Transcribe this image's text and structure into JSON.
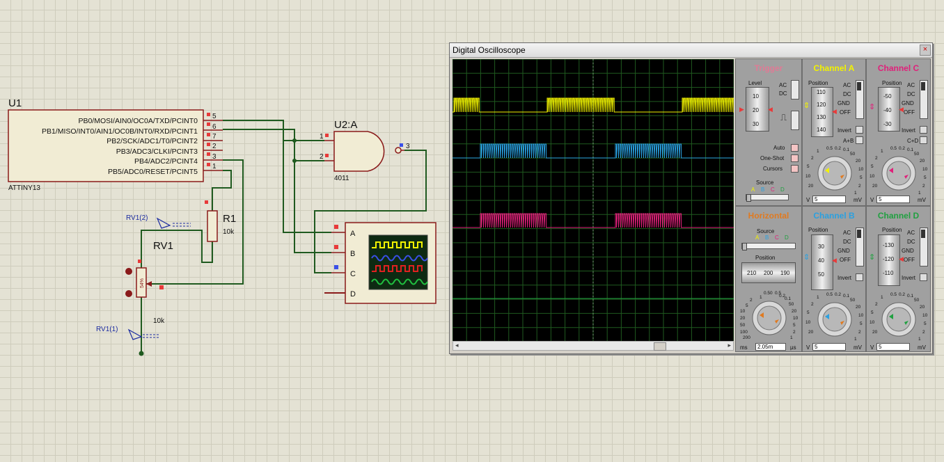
{
  "schematic": {
    "u1": {
      "ref": "U1",
      "part": "ATTINY13",
      "pins": [
        {
          "name": "PB0/MOSI/AIN0/OC0A/TXD/PCINT0",
          "num": "5"
        },
        {
          "name": "PB1/MISO/INT0/AIN1/OC0B/INT0/RXD/PCINT1",
          "num": "6"
        },
        {
          "name": "PB2/SCK/ADC1/T0/PCINT2",
          "num": "7"
        },
        {
          "name": "PB3/ADC3/CLKI/PCINT3",
          "num": "2"
        },
        {
          "name": "PB4/ADC2/PCINT4",
          "num": "3"
        },
        {
          "name": "PB5/ADC0/RESET/PCINT5",
          "num": "1"
        }
      ]
    },
    "u2": {
      "ref": "U2:A",
      "part": "4011",
      "pin1": "1",
      "pin2": "2",
      "pin3": "3"
    },
    "r1": {
      "ref": "R1",
      "value": "10k"
    },
    "rv1": {
      "ref": "RV1",
      "value": "10k",
      "percent": "54%",
      "probe_top": "RV1(2)",
      "probe_bottom": "RV1(1)"
    },
    "scope_symbol": {
      "channels": [
        "A",
        "B",
        "C",
        "D"
      ]
    }
  },
  "oscilloscope": {
    "title": "Digital Oscilloscope",
    "close": "×",
    "trigger": {
      "title": "Trigger",
      "level_label": "Level",
      "level_ticks": [
        "10",
        "20",
        "30"
      ],
      "ac": "AC",
      "dc": "DC",
      "buttons": [
        "Auto",
        "One-Shot",
        "Cursors"
      ],
      "source_label": "Source",
      "sources": [
        "A",
        "B",
        "C",
        "D"
      ]
    },
    "horizontal": {
      "title": "Horizontal",
      "source_label": "Source",
      "sources": [
        "A",
        "B",
        "C",
        "D"
      ],
      "position_label": "Position",
      "position_ticks": [
        "210",
        "200",
        "190"
      ],
      "dial_ticks": [
        "0.50",
        "1",
        "2",
        "5",
        "10",
        "20",
        "50",
        "100",
        "200",
        "0.5",
        "0.2",
        "0.1",
        "50",
        "20",
        "10",
        "5",
        "2",
        "1"
      ],
      "unit_left": "ms",
      "value": "2.05m",
      "unit_right": "µs"
    },
    "channels": [
      {
        "id": "A",
        "title": "Channel A",
        "color": "#f2f200",
        "position_ticks": [
          "110",
          "120",
          "130",
          "140"
        ],
        "modes": [
          "AC",
          "DC",
          "GND",
          "OFF"
        ],
        "invert": "Invert",
        "extra": "A+B",
        "value": "5",
        "unit_left": "V",
        "unit_right": "mV",
        "dial_ticks": [
          "0.5",
          "0.2",
          "0.1",
          "50",
          "20",
          "10",
          "5",
          "2",
          "1",
          "20",
          "10",
          "5",
          "2",
          "1"
        ]
      },
      {
        "id": "C",
        "title": "Channel C",
        "color": "#e0207a",
        "position_ticks": [
          "-50",
          "-40",
          "-30"
        ],
        "modes": [
          "AC",
          "DC",
          "GND",
          "OFF"
        ],
        "invert": "Invert",
        "extra": "C+D",
        "value": "5",
        "unit_left": "V",
        "unit_right": "mV",
        "dial_ticks": [
          "0.5",
          "0.2",
          "0.1",
          "50",
          "20",
          "10",
          "5",
          "2",
          "1",
          "20",
          "10",
          "5",
          "2",
          "1"
        ]
      },
      {
        "id": "B",
        "title": "Channel B",
        "color": "#2aa0e0",
        "position_ticks": [
          "30",
          "40",
          "50"
        ],
        "modes": [
          "AC",
          "DC",
          "GND",
          "OFF"
        ],
        "invert": "Invert",
        "extra": "",
        "value": "5",
        "unit_left": "V",
        "unit_right": "mV",
        "dial_ticks": [
          "0.5",
          "0.2",
          "0.1",
          "50",
          "20",
          "10",
          "5",
          "2",
          "1",
          "20",
          "10",
          "5",
          "2",
          "1"
        ]
      },
      {
        "id": "D",
        "title": "Channel D",
        "color": "#20a040",
        "position_ticks": [
          "-130",
          "-120",
          "-110"
        ],
        "modes": [
          "AC",
          "DC",
          "GND",
          "OFF"
        ],
        "invert": "Invert",
        "extra": "",
        "value": "5",
        "unit_left": "V",
        "unit_right": "mV",
        "dial_ticks": [
          "0.5",
          "0.2",
          "0.1",
          "50",
          "20",
          "10",
          "5",
          "2",
          "1",
          "20",
          "10",
          "5",
          "2",
          "1"
        ]
      }
    ]
  }
}
